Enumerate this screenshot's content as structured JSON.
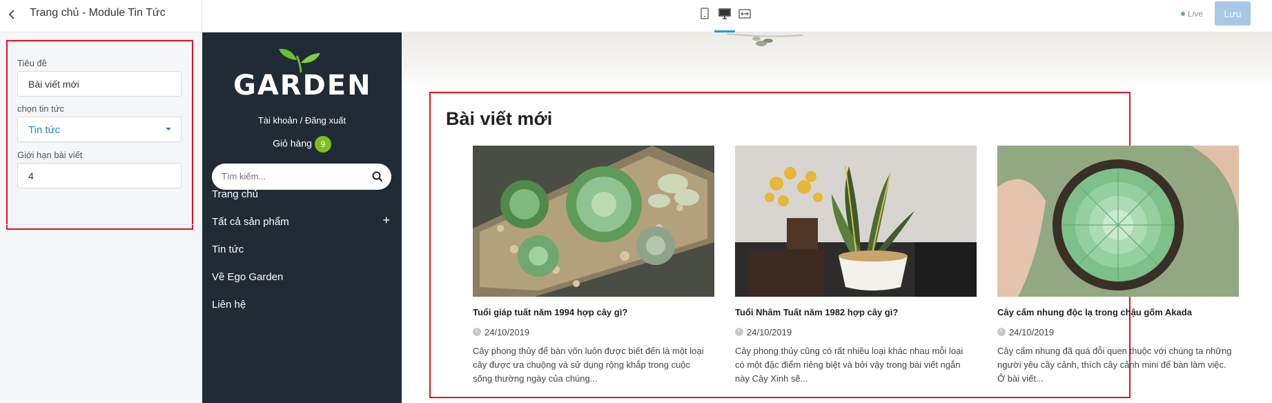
{
  "topbar": {
    "title": "Trang chủ - Module Tin Tức",
    "live_label": "Live",
    "save_label": "Lưu"
  },
  "settings": {
    "title_label": "Tiêu đề",
    "title_value": "Bài viết mới",
    "news_label": "chọn tin tức",
    "news_value": "Tin tức",
    "limit_label": "Giới hạn bài viết",
    "limit_value": "4"
  },
  "sidebar": {
    "logo_text": "GARDEN",
    "account_link": "Tài khoản / Đăng xuất",
    "cart_label": "Giỏ hàng",
    "cart_count": "9",
    "search_placeholder": "Tìm kiếm...",
    "nav": [
      {
        "label": "Trang chủ"
      },
      {
        "label": "Tất cả sản phẩm",
        "expand": "+"
      },
      {
        "label": "Tin tức"
      },
      {
        "label": "Về Ego Garden"
      },
      {
        "label": "Liên hệ"
      }
    ]
  },
  "news": {
    "heading": "Bài viết mới",
    "posts": [
      {
        "title": "Tuổi giáp tuất năm 1994 hợp cây gì?",
        "date": "24/10/2019",
        "excerpt": "Cây phong thủy để bàn vốn luôn được biết đến là một loại cây được ưa chuộng và sử dụng rộng khắp trong cuộc sống thường ngày của chúng..."
      },
      {
        "title": "Tuổi Nhâm Tuất năm 1982 hợp cây gì?",
        "date": "24/10/2019",
        "excerpt": "Cây phong thủy cũng có rất nhiều loại khác nhau mỗi loại có một đặc điểm riêng biệt và bởi vậy trong bài viết ngắn này Cây Xinh sẽ..."
      },
      {
        "title": "Cây cẩm nhung độc lạ trong chậu gốm Akada",
        "date": "24/10/2019",
        "excerpt": "Cây cẩm nhung đã quá đỗi quen thuộc với chúng ta những người yêu cây cảnh, thích cây cảnh mini để bàn làm việc. Ở bài viết..."
      }
    ]
  },
  "colors": {
    "accent": "#1e9be0",
    "highlight_border": "#e5111d",
    "sidebar_bg": "#212b36",
    "cart_badge": "#7bc11d",
    "save_button": "#a7c8e6"
  },
  "icons": [
    "back-arrow-icon",
    "mobile-icon",
    "desktop-icon",
    "fullwidth-icon",
    "search-icon",
    "clock-icon",
    "leaf-logo-icon"
  ]
}
